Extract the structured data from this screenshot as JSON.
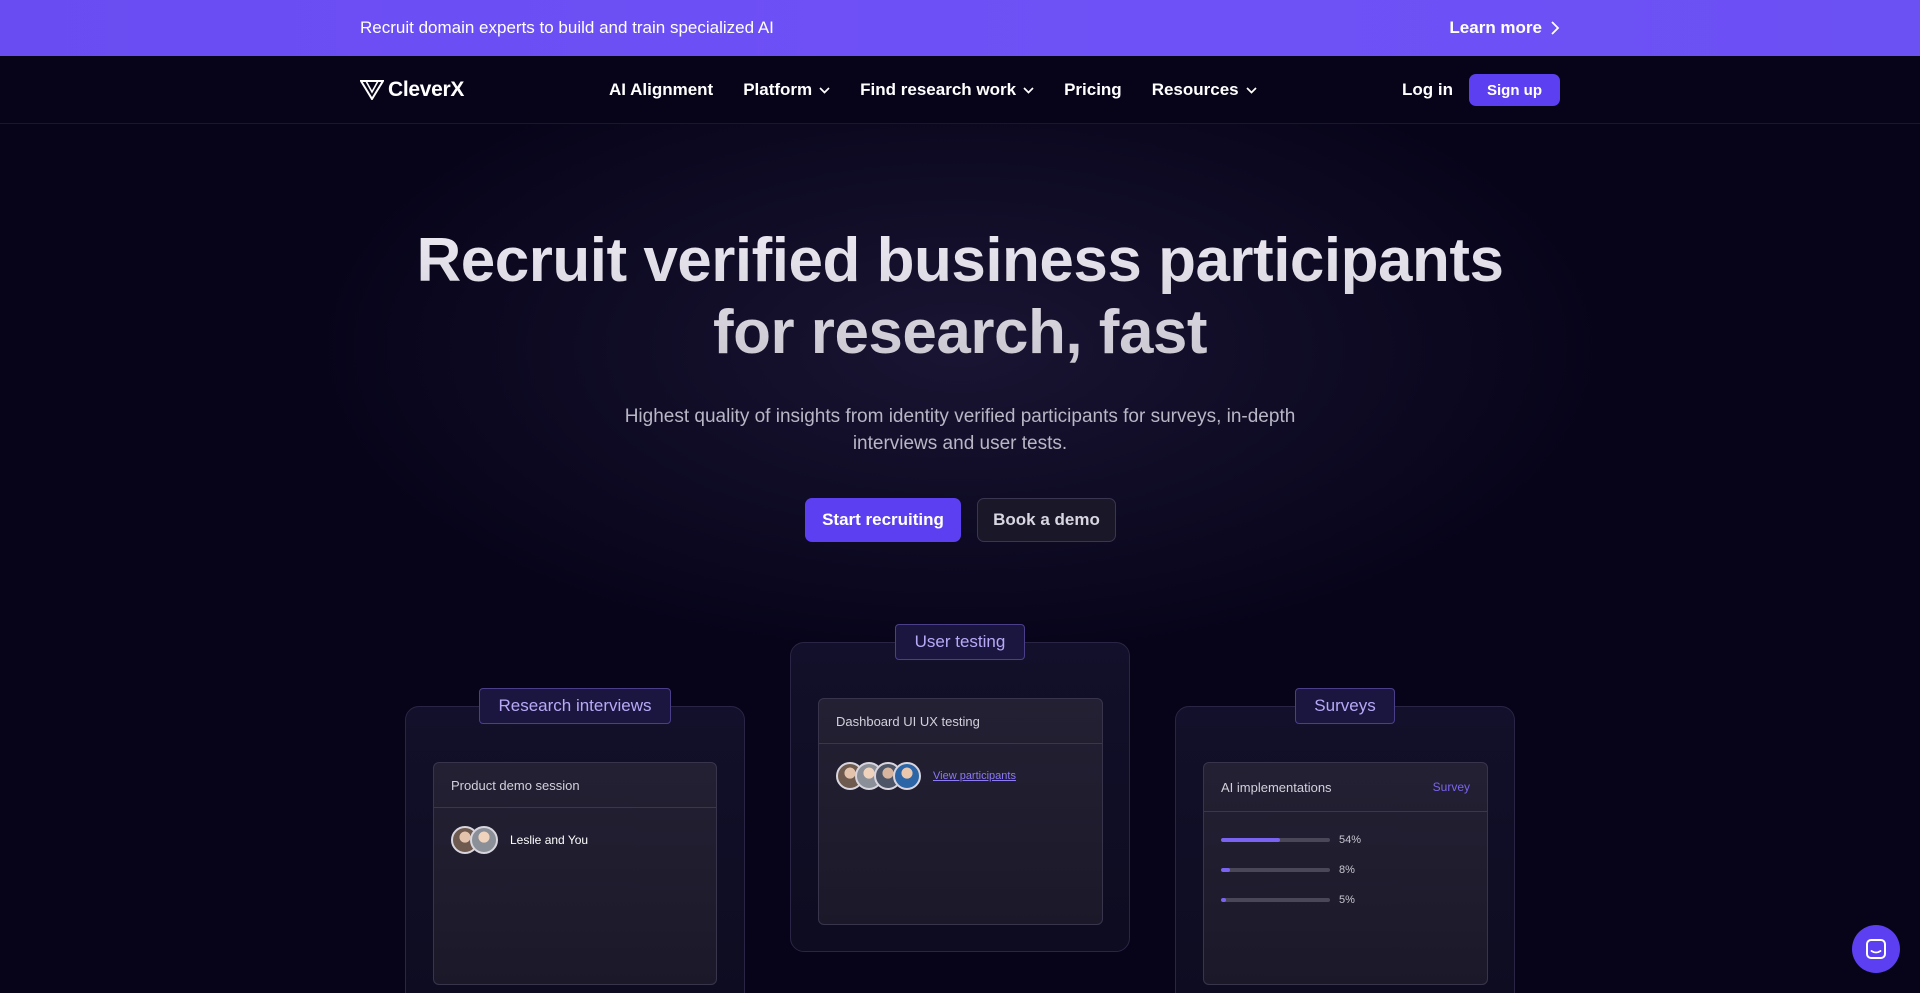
{
  "announcement": {
    "text": "Recruit domain experts to build and train specialized AI",
    "link_label": "Learn more"
  },
  "nav": {
    "logo": "CleverX",
    "items": [
      {
        "label": "AI Alignment",
        "dropdown": false
      },
      {
        "label": "Platform",
        "dropdown": true
      },
      {
        "label": "Find research work",
        "dropdown": true
      },
      {
        "label": "Pricing",
        "dropdown": false
      },
      {
        "label": "Resources",
        "dropdown": true
      }
    ],
    "login_label": "Log in",
    "signup_label": "Sign up"
  },
  "hero": {
    "title_line1": "Recruit verified business participants",
    "title_line2": "for research, fast",
    "subtitle_line1": "Highest quality of insights from identity verified participants for surveys, in-depth",
    "subtitle_line2": "interviews and user tests.",
    "primary_cta": "Start recruiting",
    "secondary_cta": "Book a demo"
  },
  "cards": {
    "interviews": {
      "tag": "Research interviews",
      "session_title": "Product demo session",
      "participants_text": "Leslie and You"
    },
    "testing": {
      "tag": "User testing",
      "session_title": "Dashboard UI UX testing",
      "link_label": "View participants"
    },
    "surveys": {
      "tag": "Surveys",
      "session_title": "AI implementations",
      "badge": "Survey",
      "results": [
        {
          "value": 54,
          "label": "54%"
        },
        {
          "value": 8,
          "label": "8%"
        },
        {
          "value": 5,
          "label": "5%"
        }
      ]
    }
  },
  "colors": {
    "accent": "#5b3ff0",
    "announcement_bg": "#6a4df2",
    "page_bg": "#07041a"
  },
  "icons": {
    "chat": "chat-bubble-icon",
    "chevron": "chevron-down-icon",
    "arrow": "chevron-right-icon"
  }
}
